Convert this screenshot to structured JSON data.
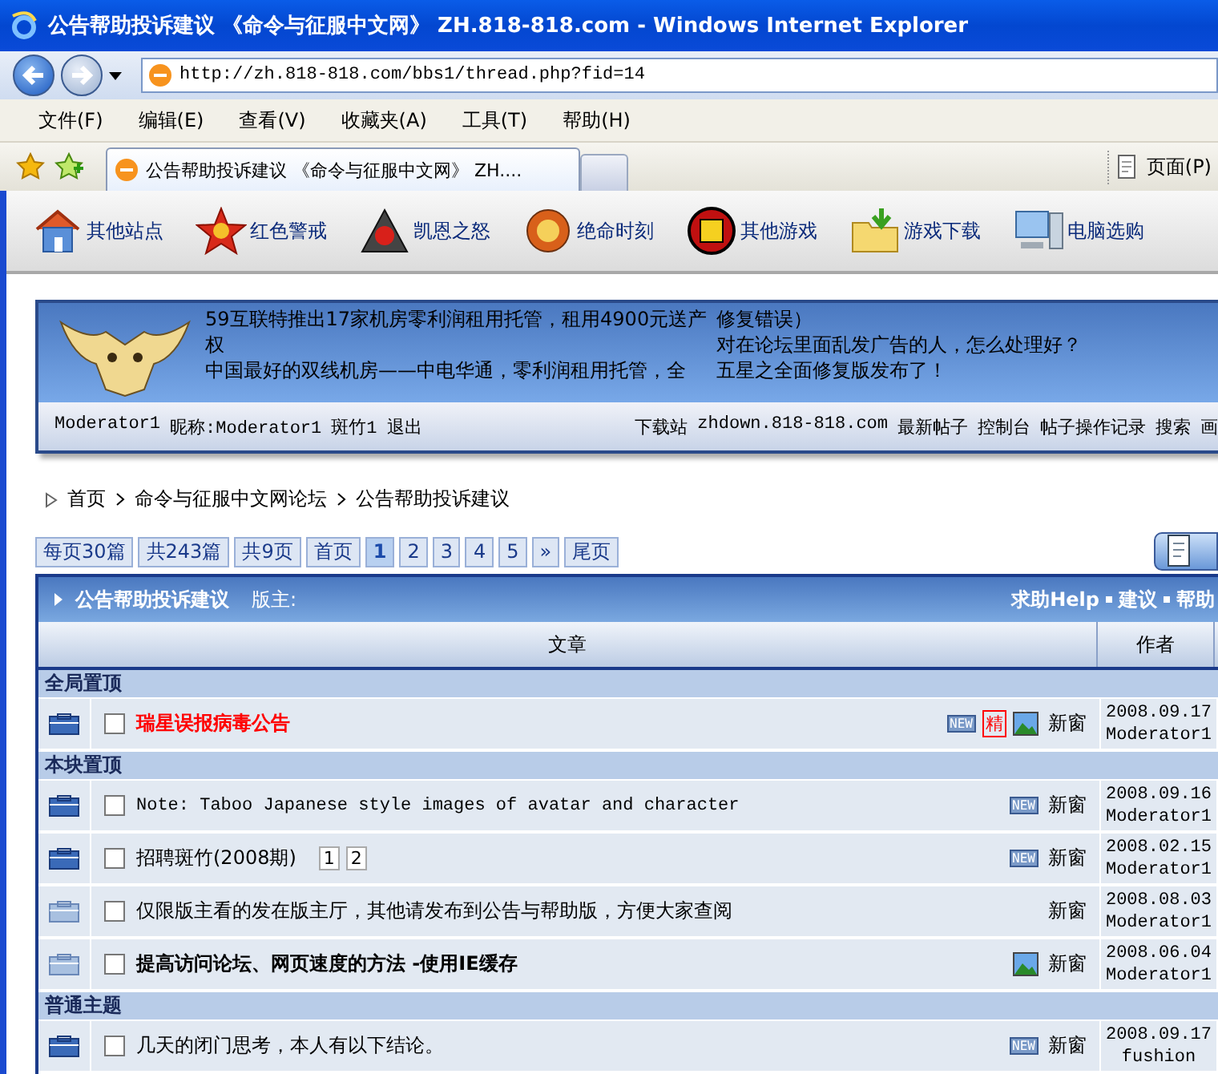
{
  "window": {
    "title": "公告帮助投诉建议 《命令与征服中文网》 ZH.818-818.com - Windows Internet Explorer"
  },
  "address_bar": {
    "url": "http://zh.818-818.com/bbs1/thread.php?fid=14"
  },
  "menu": [
    "文件(F)",
    "编辑(E)",
    "查看(V)",
    "收藏夹(A)",
    "工具(T)",
    "帮助(H)"
  ],
  "tab": {
    "title": "公告帮助投诉建议 《命令与征服中文网》 ZH...."
  },
  "command_bar": {
    "page": "页面(P)"
  },
  "site_nav": [
    {
      "label": "其他站点",
      "kind": "house"
    },
    {
      "label": "红色警戒",
      "kind": "star"
    },
    {
      "label": "凯恩之怒",
      "kind": "emblem"
    },
    {
      "label": "绝命时刻",
      "kind": "badge"
    },
    {
      "label": "其他游戏",
      "kind": "target"
    },
    {
      "label": "游戏下载",
      "kind": "download"
    },
    {
      "label": "电脑选购",
      "kind": "computer"
    }
  ],
  "banner": {
    "news_left": [
      "59互联特推出17家机房零利润租用托管，租用4900元送产",
      "权",
      "中国最好的双线机房——中电华通，零利润租用托管，全"
    ],
    "news_right": [
      "修复错误）",
      "对在论坛里面乱发广告的人，怎么处理好？",
      "五星之全面修复版发布了！"
    ]
  },
  "user_bar": {
    "left": [
      "Moderator1",
      "昵称:Moderator1",
      "斑竹1",
      "退出"
    ],
    "right": [
      "下载站",
      "zhdown.818-818.com",
      "最新帖子",
      "控制台",
      "帖子操作记录",
      "搜索",
      "画"
    ]
  },
  "breadcrumb": [
    "首页",
    "命令与征服中文网论坛",
    "公告帮助投诉建议"
  ],
  "pager": [
    {
      "label": "每页30篇",
      "selected": false
    },
    {
      "label": "共243篇",
      "selected": false
    },
    {
      "label": "共9页",
      "selected": false
    },
    {
      "label": "首页",
      "selected": false
    },
    {
      "label": "1",
      "selected": true
    },
    {
      "label": "2",
      "selected": false
    },
    {
      "label": "3",
      "selected": false
    },
    {
      "label": "4",
      "selected": false
    },
    {
      "label": "5",
      "selected": false
    },
    {
      "label": "»",
      "selected": false
    },
    {
      "label": "尾页",
      "selected": false
    }
  ],
  "forum": {
    "name": "公告帮助投诉建议",
    "moderator_label": "版主:",
    "links": [
      "求助Help",
      "建议",
      "帮助"
    ]
  },
  "columns": [
    "文章",
    "作者"
  ],
  "sections": [
    {
      "title": "全局置顶",
      "threads": [
        {
          "title": "瑞星误报病毒公告",
          "kind": "alert",
          "unread": true,
          "checked": false,
          "new_badge": "NEW",
          "digest_badge": "精",
          "image": true,
          "open_new": "新窗",
          "date": "2008.09.17",
          "author": "Moderator1"
        }
      ]
    },
    {
      "title": "本块置顶",
      "threads": [
        {
          "title": "Note: Taboo Japanese style images of avatar and character",
          "kind": "latin",
          "unread": true,
          "checked": false,
          "new_badge": "NEW",
          "image": false,
          "open_new": "新窗",
          "date": "2008.09.16",
          "author": "Moderator1"
        },
        {
          "title": "招聘斑竹(2008期)",
          "kind": "plain",
          "unread": true,
          "checked": false,
          "pages": [
            "1",
            "2"
          ],
          "new_badge": "NEW",
          "image": false,
          "open_new": "新窗",
          "date": "2008.02.15",
          "author": "Moderator1"
        },
        {
          "title": "仅限版主看的发在版主厅，其他请发布到公告与帮助版，方便大家查阅",
          "kind": "plain",
          "unread": false,
          "checked": false,
          "image": false,
          "open_new": "新窗",
          "date": "2008.08.03",
          "author": "Moderator1"
        },
        {
          "title": "提高访问论坛、网页速度的方法 -使用IE缓存",
          "kind": "emphasis",
          "unread": false,
          "checked": false,
          "image": true,
          "open_new": "新窗",
          "date": "2008.06.04",
          "author": "Moderator1"
        }
      ]
    },
    {
      "title": "普通主题",
      "threads": [
        {
          "title": "几天的闭门思考，本人有以下结论。",
          "kind": "plain",
          "unread": true,
          "checked": false,
          "new_badge": "NEW",
          "image": false,
          "open_new": "新窗",
          "date": "2008.09.17",
          "author": "fushion"
        }
      ]
    }
  ]
}
